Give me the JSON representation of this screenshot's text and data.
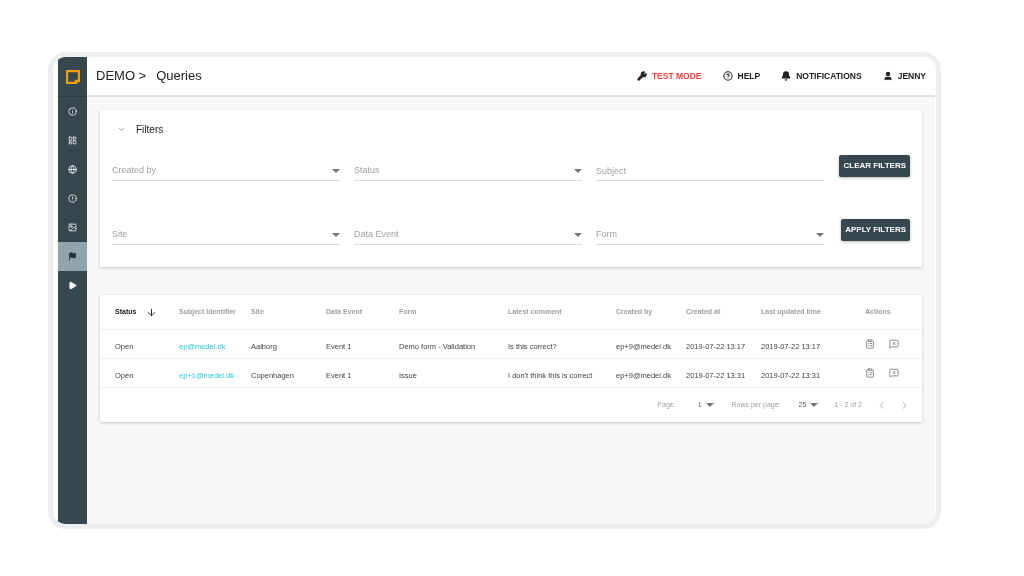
{
  "sidebar": {
    "items": [
      {
        "selected": false
      },
      {
        "selected": false
      },
      {
        "selected": false
      },
      {
        "selected": false
      },
      {
        "selected": false
      },
      {
        "selected": true
      },
      {
        "selected": false
      }
    ]
  },
  "header": {
    "breadcrumb": [
      "DEMO >",
      "Queries"
    ],
    "actions": [
      {
        "label": "TEST MODE",
        "color": "#f44336"
      },
      {
        "label": "HELP",
        "color": "#212121"
      },
      {
        "label": "NOTIFICATIONS",
        "color": "#212121"
      },
      {
        "label": "JENNY",
        "color": "#212121"
      }
    ]
  },
  "filters": {
    "title": "Filters",
    "expanded": true,
    "rows": [
      {
        "fields": [
          {
            "placeholder": "Created by",
            "kind": "select"
          },
          {
            "placeholder": "Status",
            "kind": "select"
          },
          {
            "placeholder": "Subject",
            "kind": "text"
          }
        ],
        "button": "CLEAR FILTERS"
      },
      {
        "fields": [
          {
            "placeholder": "Site",
            "kind": "select"
          },
          {
            "placeholder": "Data Event",
            "kind": "select"
          },
          {
            "placeholder": "Form",
            "kind": "select"
          }
        ],
        "button": "APPLY FILTERS"
      }
    ]
  },
  "table": {
    "columns": [
      {
        "label": "Status",
        "sorted": true
      },
      {
        "label": "Subject Identifier",
        "sorted": false
      },
      {
        "label": "Site",
        "sorted": false
      },
      {
        "label": "Data Event",
        "sorted": false
      },
      {
        "label": "Form",
        "sorted": false
      },
      {
        "label": "Latest comment",
        "sorted": false
      },
      {
        "label": "Created by",
        "sorted": false
      },
      {
        "label": "Created at",
        "sorted": false
      },
      {
        "label": "Last updated time",
        "sorted": false
      },
      {
        "label": "Actions",
        "sorted": false
      }
    ],
    "rows": [
      [
        "Open",
        "ep@medei.dk",
        "Aalborg",
        "Event 1",
        "Demo form - Validation",
        "Is this correct?",
        "ep+9@medei.dk",
        "2019-07-22 13:17",
        "2019-07-22 13:17"
      ],
      [
        "Open",
        "ep+1@medei.dk",
        "Copenhagen",
        "Event 1",
        "Issue",
        "I don't think this is correct",
        "ep+9@medei.dk",
        "2019-07-22 13:31",
        "2019-07-22 13:31"
      ]
    ],
    "pagination": {
      "page_label": "Page:",
      "page": "1",
      "rows_label": "Rows per page:",
      "rows": "25",
      "range": "1 - 2 of 2"
    }
  }
}
